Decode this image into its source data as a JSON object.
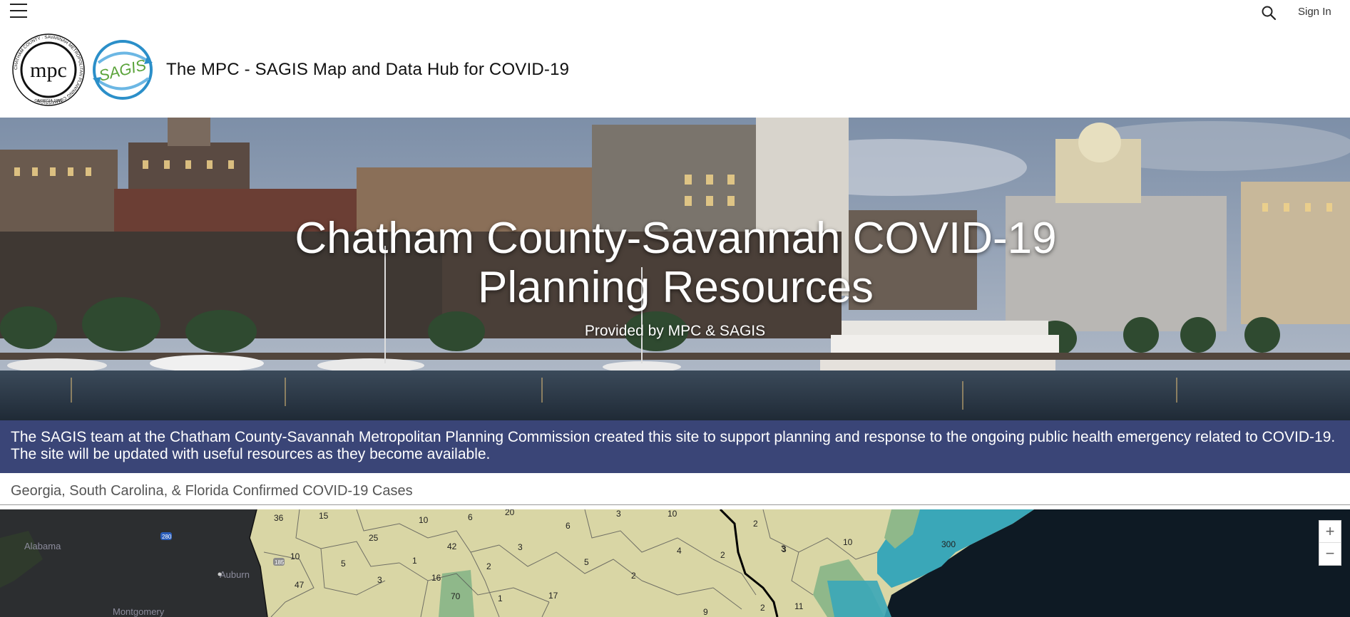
{
  "topbar": {
    "menu_icon": "hamburger-icon",
    "search_icon": "search-icon",
    "signin_label": "Sign In"
  },
  "header": {
    "logo_mpc": {
      "text": "mpc",
      "ring_text": "CHATHAM COUNTY · SAVANNAH METROPOLITAN PLANNING COMMISSION",
      "bottom_text": "GEORGIA 1955"
    },
    "logo_sagis": {
      "text": "SAGIS"
    },
    "title": "The MPC - SAGIS Map and Data Hub for COVID-19"
  },
  "hero": {
    "title": "Chatham County-Savannah COVID-19 Planning Resources",
    "subtitle": "Provided by MPC & SAGIS"
  },
  "banner": {
    "text": "The SAGIS team at the Chatham County-Savannah Metropolitan Planning Commission created this site to support planning and response to the ongoing public health emergency related to COVID-19.  The site will be updated with useful resources as they become available."
  },
  "map": {
    "heading": "Georgia, South Carolina, & Florida Confirmed COVID-19 Cases",
    "zoom_in": "+",
    "zoom_out": "−",
    "place_labels": [
      "Alabama",
      "Auburn",
      "Montgomery",
      "280",
      "185"
    ],
    "case_labels": [
      "36",
      "15",
      "10",
      "6",
      "20",
      "3",
      "10",
      "25",
      "42",
      "6",
      "10",
      "2",
      "3",
      "1",
      "3",
      "5",
      "4",
      "2",
      "3",
      "10",
      "300",
      "5",
      "2",
      "2",
      "47",
      "3",
      "16",
      "70",
      "1",
      "17",
      "2",
      "9",
      "11"
    ],
    "colors": {
      "land_dark": "#2b2d2e",
      "county_fill": "#d9d6a5",
      "green_fill": "#8fb88a",
      "teal_fill": "#3aa7b8",
      "ocean": "#0e1a24"
    }
  }
}
